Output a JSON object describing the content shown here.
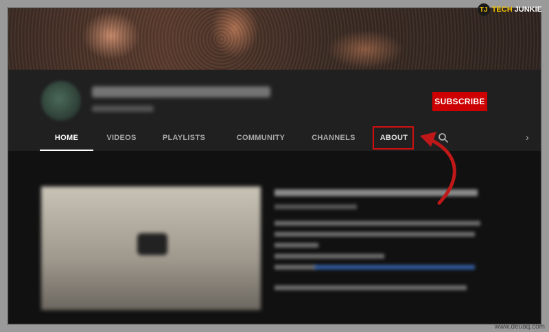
{
  "watermark": {
    "logo": "TJ",
    "tech": "TECH",
    "junkie": "JUNKIE"
  },
  "channel": {
    "subscribe_label": "SUBSCRIBE"
  },
  "tabs": [
    {
      "label": "HOME",
      "active": true
    },
    {
      "label": "VIDEOS"
    },
    {
      "label": "PLAYLISTS"
    },
    {
      "label": "COMMUNITY"
    },
    {
      "label": "CHANNELS"
    },
    {
      "label": "ABOUT",
      "highlighted": true
    }
  ],
  "icons": {
    "search": "search-icon",
    "next": "chevron-right-icon"
  },
  "colors": {
    "subscribe": "#cc0000",
    "highlight": "#d01010",
    "arrow": "#c01818",
    "watermark": "#f2c200"
  },
  "footer": {
    "source": "www.deuaq.com"
  }
}
